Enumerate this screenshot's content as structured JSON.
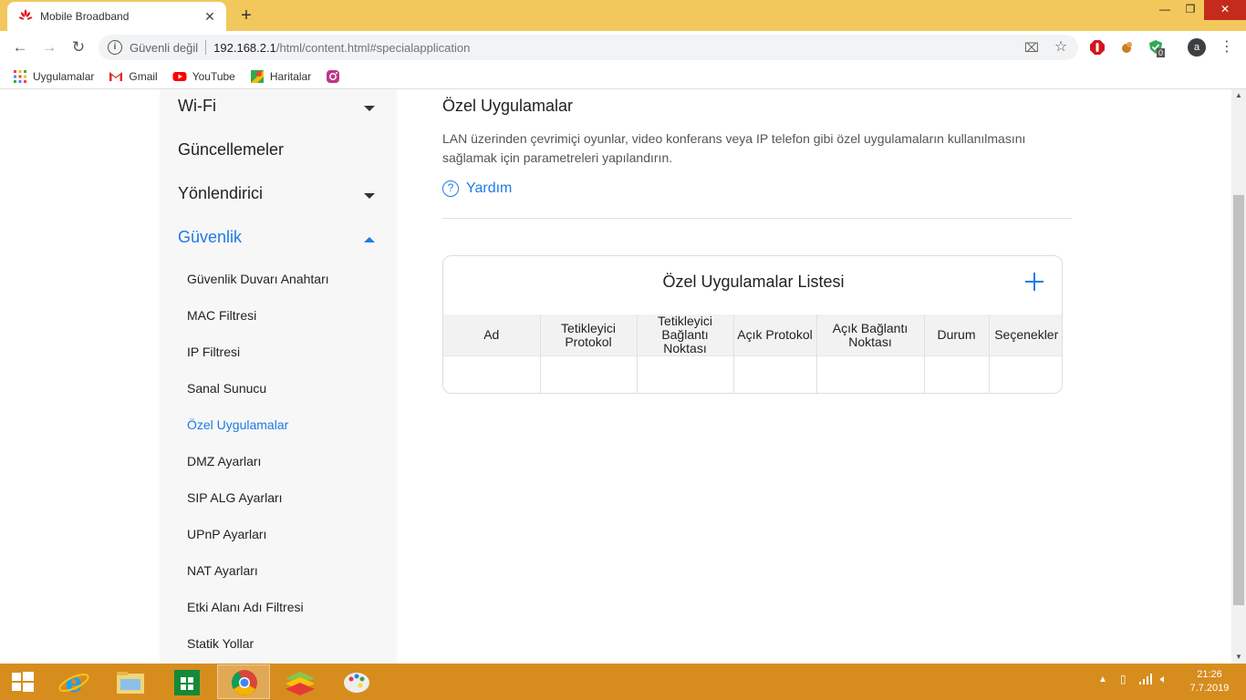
{
  "browser": {
    "tab_title": "Mobile Broadband",
    "tab_close": "✕",
    "new_tab": "+",
    "window_controls": {
      "minimize": "—",
      "maximize": "❐",
      "close": "✕"
    },
    "address": {
      "security_label": "Güvenli değil",
      "host": "192.168.2.1",
      "path": "/html/content.html#specialapplication"
    },
    "extensions": {
      "shield_badge": "0",
      "profile_initial": "a"
    }
  },
  "bookmarks": [
    {
      "label": "Uygulamalar",
      "icon": "apps-grid-icon"
    },
    {
      "label": "Gmail",
      "icon": "gmail-icon"
    },
    {
      "label": "YouTube",
      "icon": "youtube-icon"
    },
    {
      "label": "Haritalar",
      "icon": "maps-icon"
    },
    {
      "label": "",
      "icon": "instagram-icon"
    }
  ],
  "sidebar": {
    "main": [
      {
        "label": "Wi-Fi",
        "expanded": false
      },
      {
        "label": "Güncellemeler"
      },
      {
        "label": "Yönlendirici",
        "expanded": false
      },
      {
        "label": "Güvenlik",
        "expanded": true,
        "active": true
      }
    ],
    "security_items": [
      "Güvenlik Duvarı Anahtarı",
      "MAC Filtresi",
      "IP Filtresi",
      "Sanal Sunucu",
      "Özel Uygulamalar",
      "DMZ Ayarları",
      "SIP ALG Ayarları",
      "UPnP Ayarları",
      "NAT Ayarları",
      "Etki Alanı Adı Filtresi",
      "Statik Yollar"
    ],
    "active_item": "Özel Uygulamalar"
  },
  "content": {
    "title": "Özel Uygulamalar",
    "description": "LAN üzerinden çevrimiçi oyunlar, video konferans veya IP telefon gibi özel uygulamaların kullanılmasını sağlamak için parametreleri yapılandırın.",
    "help_label": "Yardım",
    "list_title": "Özel Uygulamalar Listesi",
    "columns": [
      "Ad",
      "Tetikleyici Protokol",
      "Tetikleyici Bağlantı Noktası",
      "Açık Protokol",
      "Açık Bağlantı Noktası",
      "Durum",
      "Seçenekler"
    ],
    "rows": []
  },
  "taskbar": {
    "time": "21:26",
    "date": "7.7.2019",
    "accent": "#d78c1e"
  }
}
